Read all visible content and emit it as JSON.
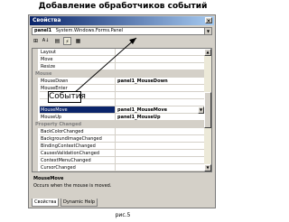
{
  "heading": "Добавление обработчиков событий",
  "window": {
    "title": "Свойства",
    "close": "×"
  },
  "object_selector": {
    "name": "panel1",
    "type": "System.Windows.Forms.Panel",
    "dropdown": "▼"
  },
  "toolbar": {
    "categorized": "⊞",
    "alphabetic": "A↓",
    "properties": "▤",
    "events": "⚡",
    "pages": "▦"
  },
  "rows": [
    {
      "kind": "prop",
      "name": "Layout",
      "value": ""
    },
    {
      "kind": "prop",
      "name": "Move",
      "value": ""
    },
    {
      "kind": "prop",
      "name": "Resize",
      "value": ""
    },
    {
      "kind": "cat",
      "name": "Mouse",
      "value": ""
    },
    {
      "kind": "prop",
      "name": "MouseDown",
      "value": "panel1_MouseDown"
    },
    {
      "kind": "prop",
      "name": "MouseEnter",
      "value": ""
    },
    {
      "kind": "prop",
      "name": "",
      "value": ""
    },
    {
      "kind": "prop",
      "name": "",
      "value": ""
    },
    {
      "kind": "sel",
      "name": "MouseMove",
      "value": "panel1_MouseMove"
    },
    {
      "kind": "prop",
      "name": "MouseUp",
      "value": "panel1_MouseUp"
    },
    {
      "kind": "cat",
      "name": "Property Changed",
      "value": ""
    },
    {
      "kind": "prop",
      "name": "BackColorChanged",
      "value": ""
    },
    {
      "kind": "prop",
      "name": "BackgroundImageChanged",
      "value": ""
    },
    {
      "kind": "prop",
      "name": "BindingContextChanged",
      "value": ""
    },
    {
      "kind": "prop",
      "name": "CausesValidationChanged",
      "value": ""
    },
    {
      "kind": "prop",
      "name": "ContextMenuChanged",
      "value": ""
    },
    {
      "kind": "prop",
      "name": "CursorChanged",
      "value": ""
    }
  ],
  "description": {
    "title": "MouseMove",
    "text": "Occurs when the mouse is moved."
  },
  "tabs": [
    {
      "label": "Свойства"
    },
    {
      "label": "Dynamic Help"
    }
  ],
  "callout": "События",
  "caption": "рис.5"
}
